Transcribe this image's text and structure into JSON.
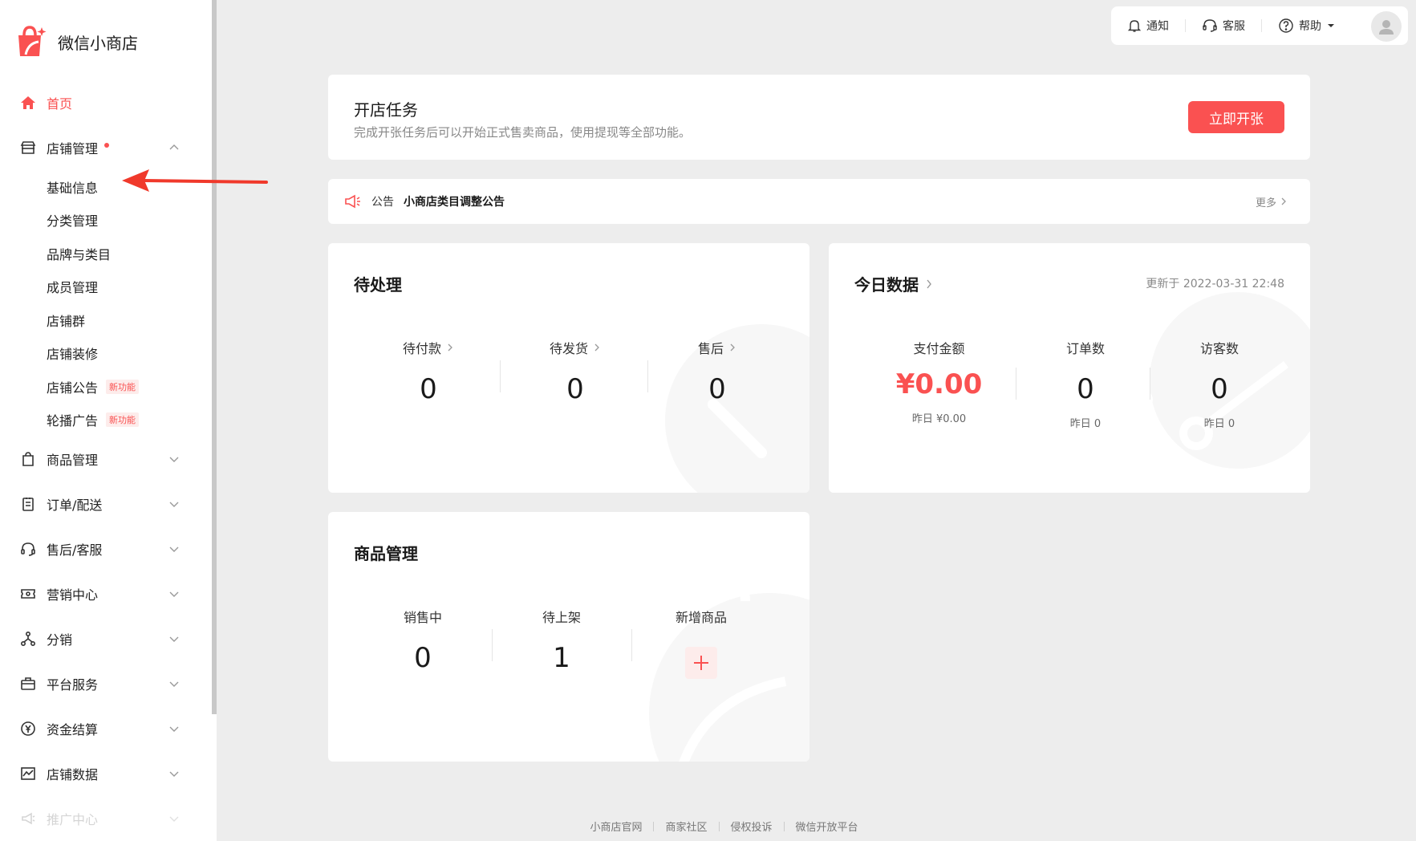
{
  "app": {
    "name": "微信小商店"
  },
  "sidebar": {
    "home": "首页",
    "store_mgmt": "店铺管理",
    "store_sub": [
      {
        "label": "基础信息"
      },
      {
        "label": "分类管理"
      },
      {
        "label": "品牌与类目"
      },
      {
        "label": "成员管理"
      },
      {
        "label": "店铺群"
      },
      {
        "label": "店铺装修"
      },
      {
        "label": "店铺公告",
        "badge": "新功能"
      },
      {
        "label": "轮播广告",
        "badge": "新功能"
      }
    ],
    "goods": "商品管理",
    "orders": "订单/配送",
    "after_sales": "售后/客服",
    "marketing": "营销中心",
    "distribution": "分销",
    "platform": "平台服务",
    "finance": "资金结算",
    "data": "店铺数据",
    "promotion": "推广中心"
  },
  "topbar": {
    "notify": "通知",
    "service": "客服",
    "help": "帮助"
  },
  "task": {
    "title": "开店任务",
    "desc": "完成开张任务后可以开始正式售卖商品，使用提现等全部功能。",
    "button": "立即开张"
  },
  "notice": {
    "tag": "公告",
    "title": "小商店类目调整公告",
    "more": "更多"
  },
  "pending": {
    "title": "待处理",
    "items": [
      {
        "label": "待付款",
        "value": "0"
      },
      {
        "label": "待发货",
        "value": "0"
      },
      {
        "label": "售后",
        "value": "0"
      }
    ]
  },
  "today": {
    "title": "今日数据",
    "updated": "更新于 2022-03-31 22:48",
    "items": [
      {
        "label": "支付金额",
        "value": "¥0.00",
        "yesterday": "昨日 ¥0.00"
      },
      {
        "label": "订单数",
        "value": "0",
        "yesterday": "昨日 0"
      },
      {
        "label": "访客数",
        "value": "0",
        "yesterday": "昨日 0"
      }
    ]
  },
  "goods": {
    "title": "商品管理",
    "items": [
      {
        "label": "销售中",
        "value": "0"
      },
      {
        "label": "待上架",
        "value": "1"
      },
      {
        "label": "新增商品"
      }
    ]
  },
  "footer": {
    "links": [
      "小商店官网",
      "商家社区",
      "侵权投诉",
      "微信开放平台"
    ]
  },
  "colors": {
    "accent": "#fa5151",
    "background": "#ededed"
  }
}
